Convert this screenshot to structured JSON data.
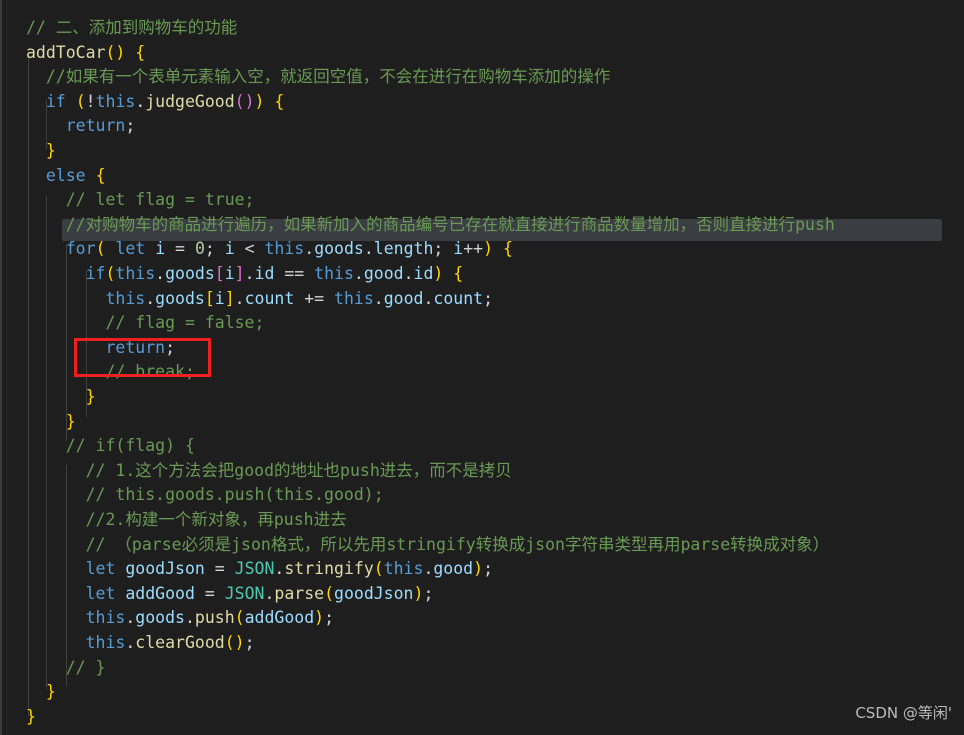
{
  "editor": {
    "background_color": "#1e1e1e",
    "language": "javascript",
    "font_size_px": 16.5,
    "line_height_px": 24.6,
    "total_lines": 29
  },
  "theme": {
    "comment": "#6a9955",
    "keyword": "#569cd6",
    "function": "#dcdcaa",
    "variable": "#9cdcfe",
    "number": "#b5cea8",
    "plain": "#d4d4d4",
    "bracket_gold": "#ffd700",
    "bracket_orchid": "#da70d6",
    "bracket_blue": "#179fff",
    "selection": "#3a3d41",
    "indent_guide": "#3f3f3f",
    "annotation_red": "#f02020"
  },
  "code_lines": [
    "// 二、添加到购物车的功能",
    "addToCar() {",
    "  //如果有一个表单元素输入空，就返回空值，不会在进行在购物车添加的操作",
    "  if (!this.judgeGood()) {",
    "    return;",
    "  }",
    "  else {",
    "    // let flag = true;",
    "    //对购物车的商品进行遍历，如果新加入的商品编号已存在就直接进行商品数量增加，否则直接进行push",
    "    for( let i = 0; i < this.goods.length; i++) {",
    "      if(this.goods[i].id == this.good.id) {",
    "        this.goods[i].count += this.good.count;",
    "        // flag = false;",
    "        return;",
    "        // break;",
    "      }",
    "    }",
    "    // if(flag) {",
    "      // 1.这个方法会把good的地址也push进去，而不是拷贝",
    "      // this.goods.push(this.good);",
    "      //2.构建一个新对象，再push进去",
    "      // （parse必须是json格式，所以先用stringify转换成json字符串类型再用parse转换成对象）",
    "      let goodJson = JSON.stringify(this.good);",
    "      let addGood = JSON.parse(goodJson);",
    "      this.goods.push(addGood);",
    "      this.clearGood();",
    "    // }",
    "  }",
    "}"
  ],
  "selection": {
    "line_index": 8,
    "selected_text": "//对购物车的商品进行遍历，如果新加入的商品编号已存在就直接进行商品数量增加，否则直接进行push"
  },
  "annotation": {
    "type": "red-rectangle",
    "target_line_index": 13,
    "target_text": "return;",
    "color": "#f02020"
  },
  "watermark": {
    "text": "CSDN @等闲'"
  }
}
